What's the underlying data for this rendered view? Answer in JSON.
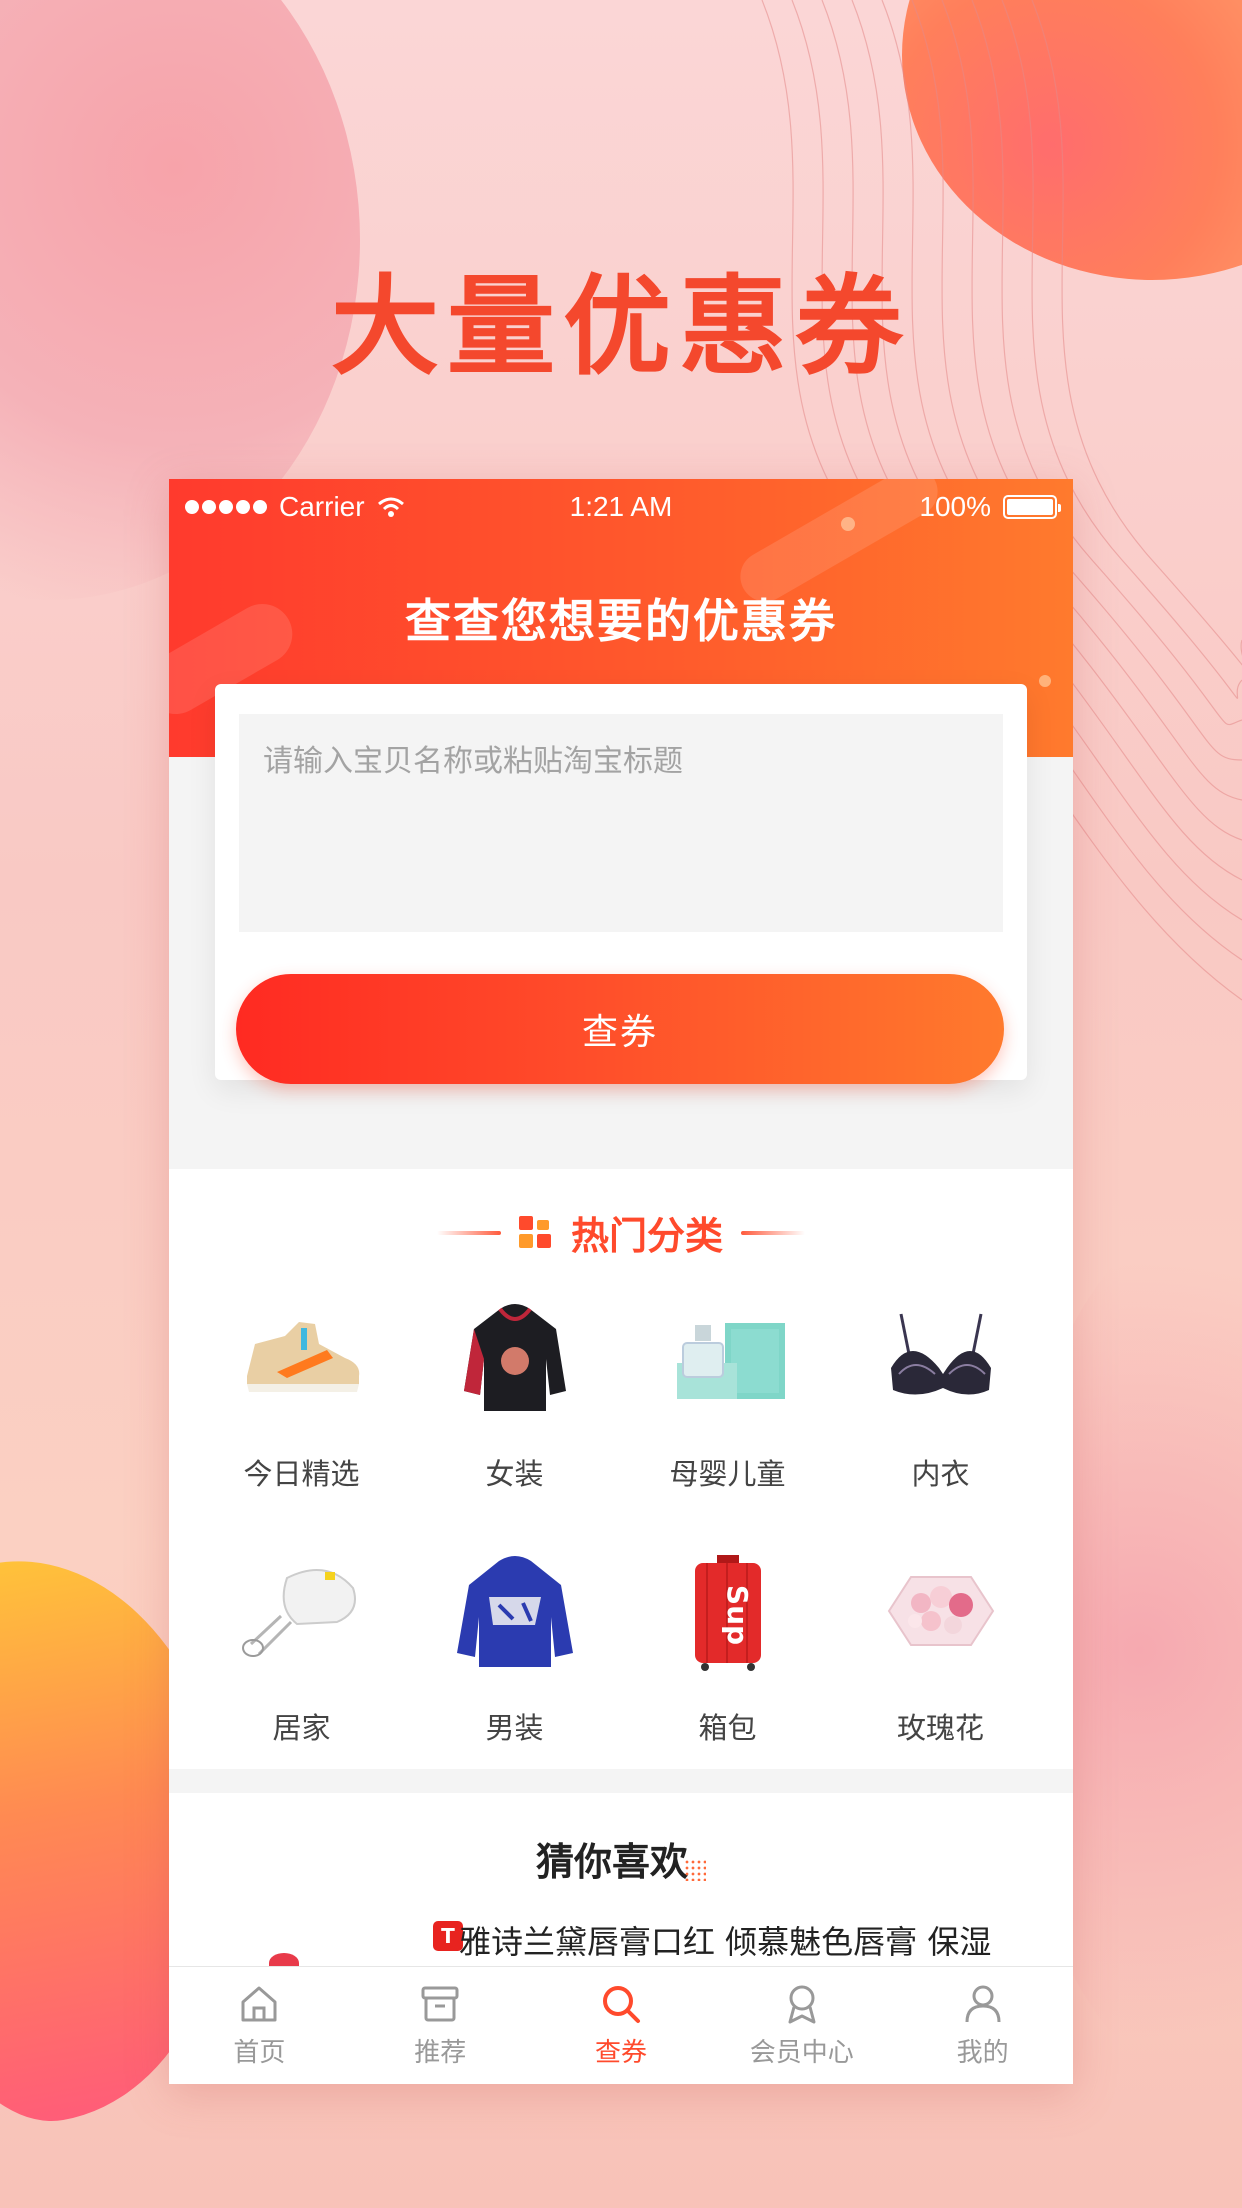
{
  "promo_title": "大量优惠券",
  "status_bar": {
    "carrier": "Carrier",
    "time": "1:21 AM",
    "battery": "100%"
  },
  "header": {
    "title": "查查您想要的优惠券"
  },
  "search": {
    "placeholder": "请输入宝贝名称或粘贴淘宝标题",
    "value": "",
    "button_label": "查券"
  },
  "categories": {
    "title": "热门分类",
    "items": [
      {
        "label": "今日精选",
        "icon": "sneaker-icon"
      },
      {
        "label": "女装",
        "icon": "hoodie-icon"
      },
      {
        "label": "母婴儿童",
        "icon": "perfume-box-icon"
      },
      {
        "label": "内衣",
        "icon": "lingerie-icon"
      },
      {
        "label": "居家",
        "icon": "hand-mixer-icon"
      },
      {
        "label": "男装",
        "icon": "blue-hoodie-icon"
      },
      {
        "label": "箱包",
        "icon": "suitcase-icon"
      },
      {
        "label": "玫瑰花",
        "icon": "flower-box-icon"
      }
    ]
  },
  "recommend": {
    "title": "猜你喜欢",
    "product": {
      "badge": "T",
      "title": "雅诗兰黛唇膏口红 倾慕魅色唇膏 保湿"
    }
  },
  "tabs": [
    {
      "label": "首页",
      "icon": "home-icon",
      "active": false
    },
    {
      "label": "推荐",
      "icon": "archive-icon",
      "active": false
    },
    {
      "label": "查券",
      "icon": "search-icon",
      "active": true
    },
    {
      "label": "会员中心",
      "icon": "member-badge-icon",
      "active": false
    },
    {
      "label": "我的",
      "icon": "user-icon",
      "active": false
    }
  ],
  "colors": {
    "accent": "#ff4a2c",
    "promo_text": "#f4482d",
    "header_start": "#ff3a2d",
    "header_end": "#ff7a2d"
  }
}
